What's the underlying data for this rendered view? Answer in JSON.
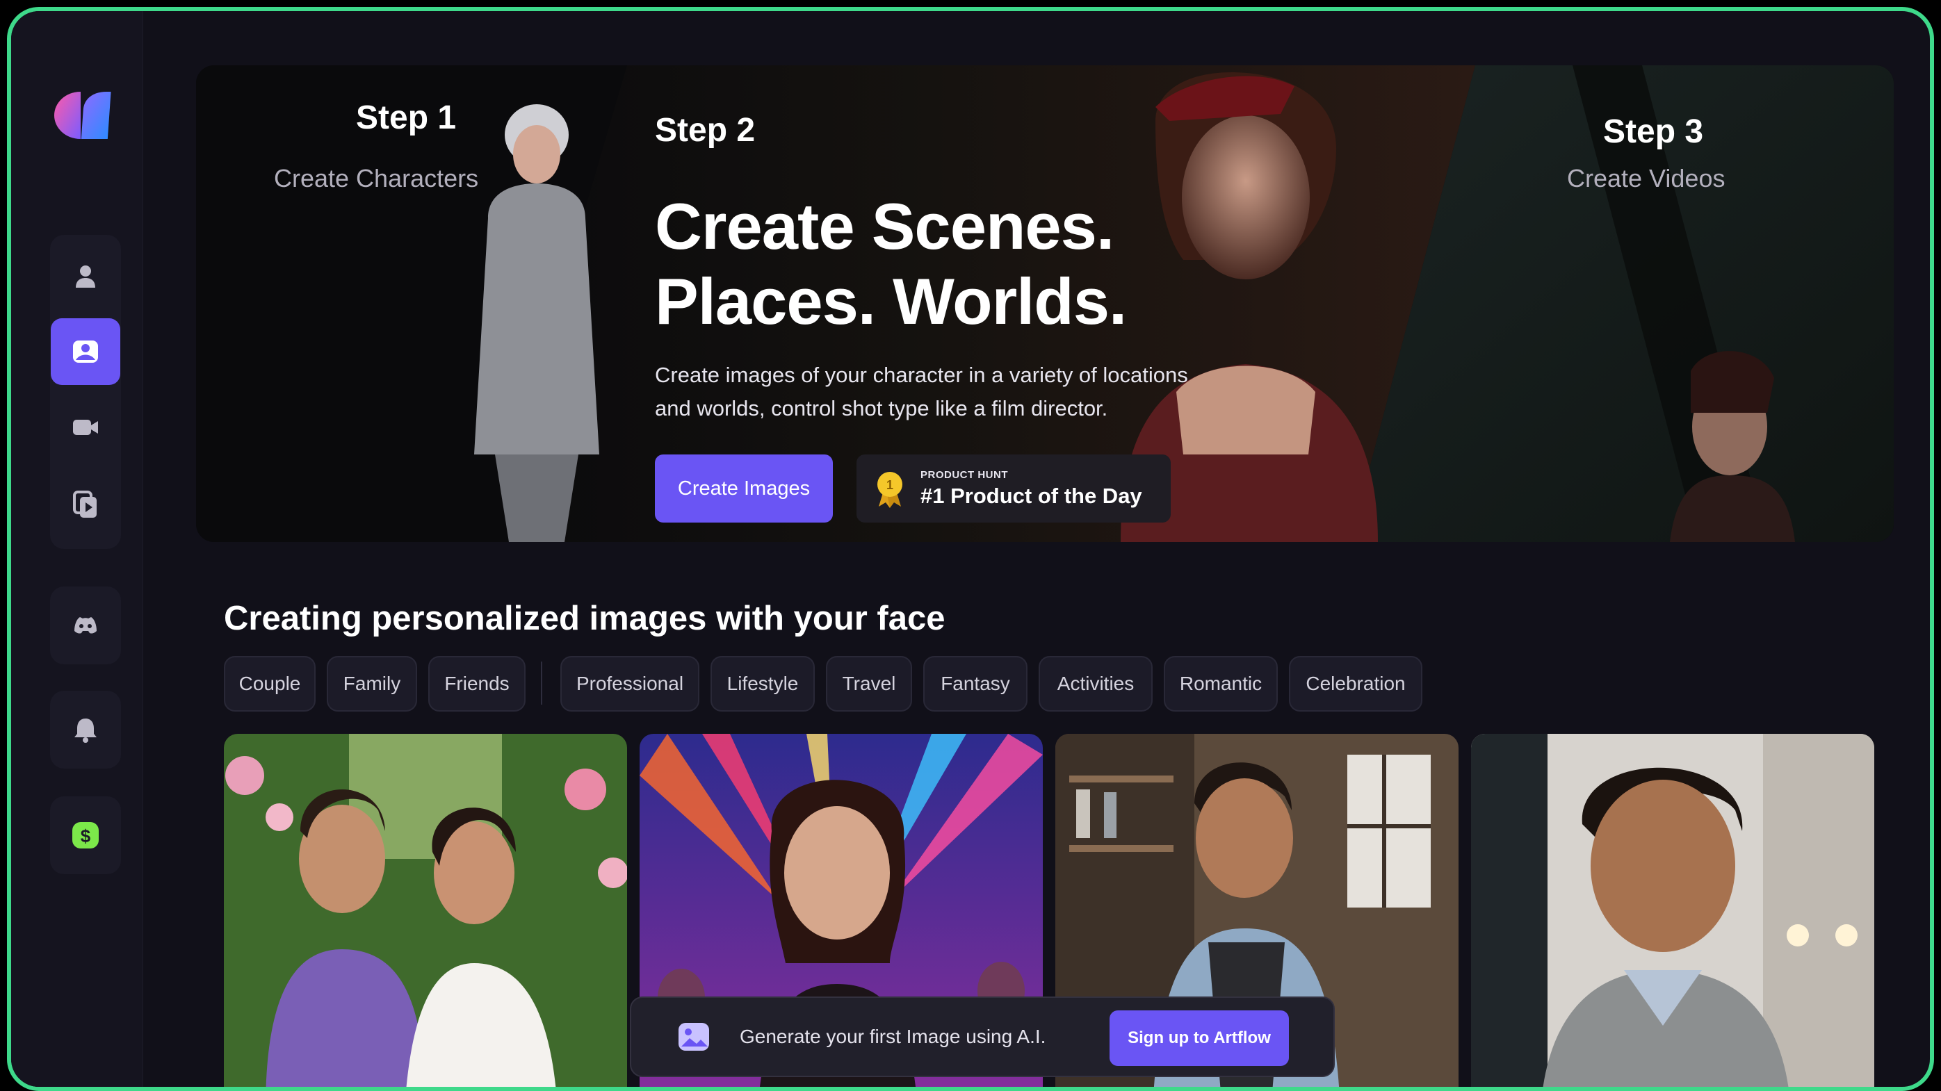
{
  "hero": {
    "step1_title": "Step 1",
    "step1_sub": "Create Characters",
    "step2_title": "Step 2",
    "heading_line1": "Create Scenes.",
    "heading_line2": "Places. Worlds.",
    "desc_line1": "Create images of your character in a variety of locations",
    "desc_line2": "and worlds, control shot type like a film director.",
    "cta_label": "Create Images",
    "badge_small": "PRODUCT HUNT",
    "badge_big": "#1 Product of the Day",
    "step3_title": "Step 3",
    "step3_sub": "Create Videos"
  },
  "sidebar": {
    "items": [
      {
        "icon": "user-icon"
      },
      {
        "icon": "image-icon",
        "active": true
      },
      {
        "icon": "video-icon"
      },
      {
        "icon": "copy-play-icon"
      },
      {
        "icon": "discord-icon"
      },
      {
        "icon": "bell-icon"
      },
      {
        "icon": "dollar-icon"
      }
    ]
  },
  "section": {
    "title": "Creating personalized images with your face",
    "chips": [
      "Couple",
      "Family",
      "Friends",
      "Professional",
      "Lifestyle",
      "Travel",
      "Fantasy",
      "Activities",
      "Romantic",
      "Celebration"
    ]
  },
  "prompt_bar": {
    "text": "Generate your first Image using A.I.",
    "button": "Sign up to Artflow"
  },
  "colors": {
    "accent": "#6a55f4",
    "frame_border": "#3ed98a",
    "background": "#111019"
  }
}
